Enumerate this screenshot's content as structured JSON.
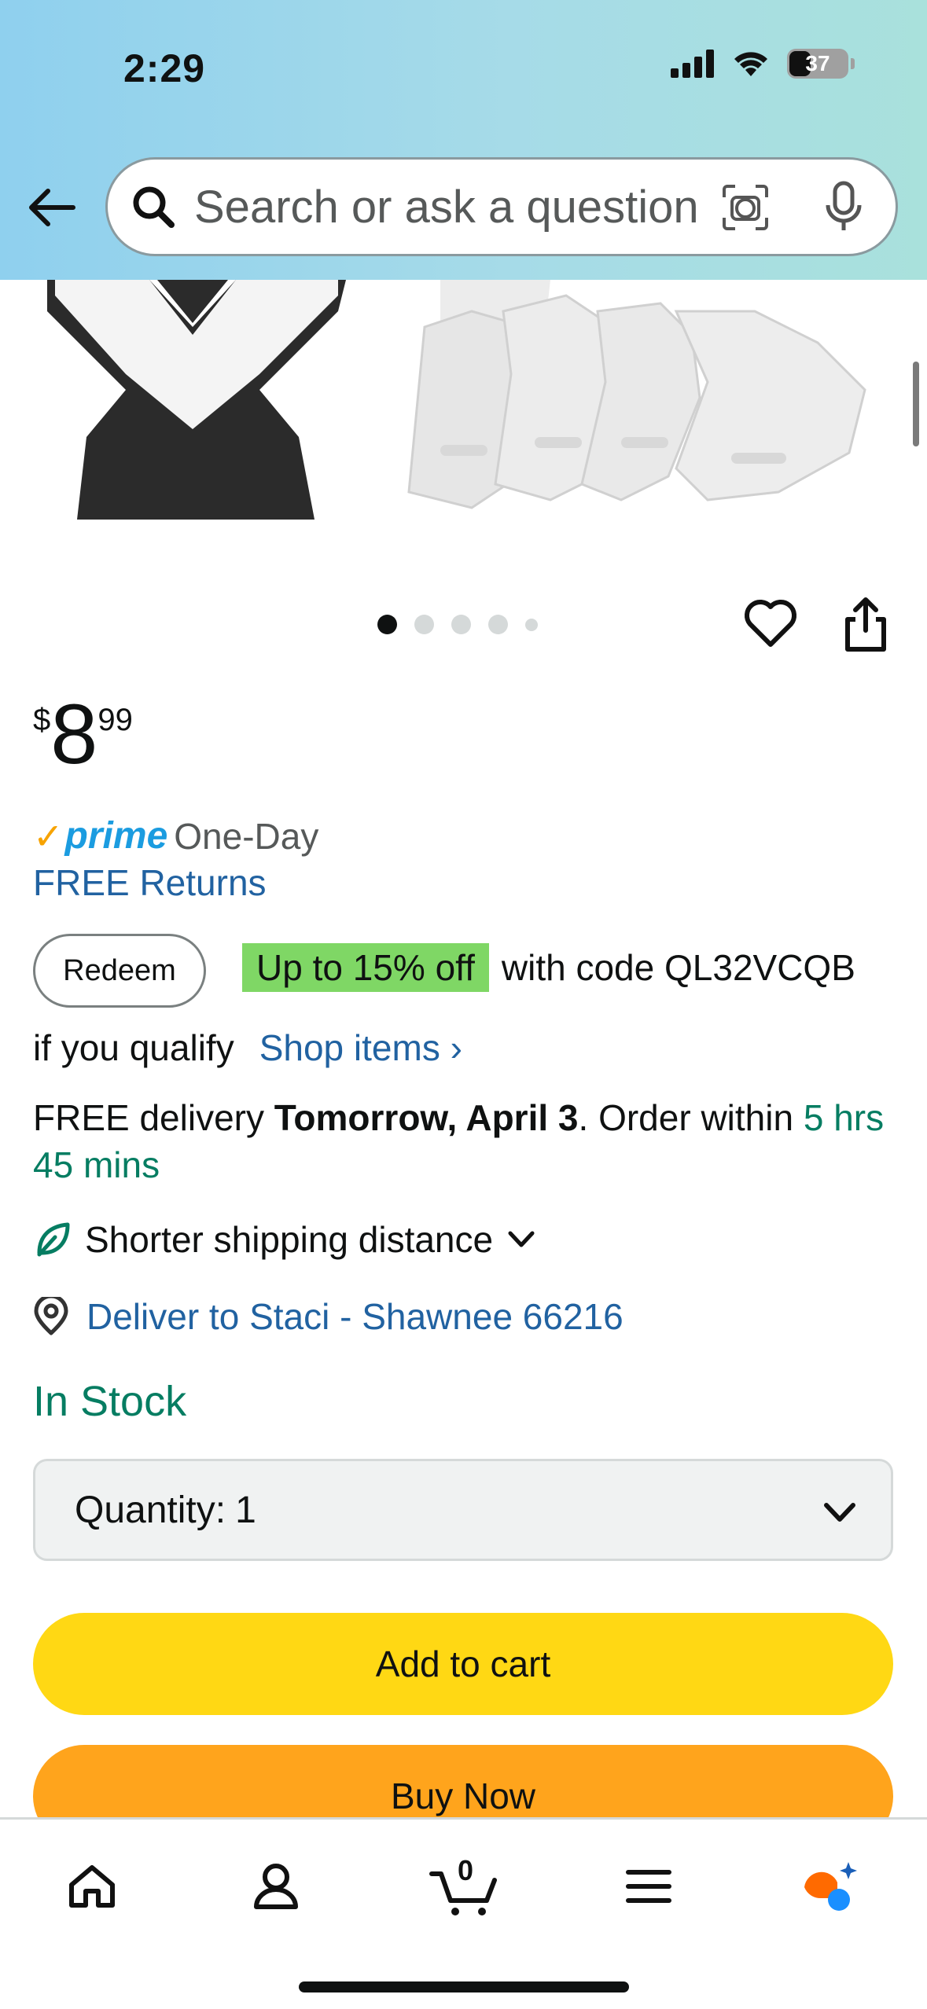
{
  "status_bar": {
    "time": "2:29",
    "battery": "37",
    "icons": [
      "signal-icon",
      "wifi-icon",
      "battery-icon"
    ]
  },
  "header": {
    "back_icon": "back-arrow-icon",
    "search": {
      "placeholder": "Search or ask a question",
      "icons": [
        "search-icon",
        "camera-lens-icon",
        "mic-icon"
      ]
    }
  },
  "gallery": {
    "dots_total": 5,
    "active_dot": 1,
    "icons": [
      "heart-icon",
      "share-icon"
    ]
  },
  "price": {
    "currency": "$",
    "whole": "8",
    "fraction": "99"
  },
  "prime": {
    "check": "✓",
    "word": "prime",
    "label": "One-Day"
  },
  "returns": "FREE Returns",
  "coupon": {
    "redeem_label": "Redeem",
    "badge": "Up to 15% off",
    "code_text": "with code QL32VCQB",
    "qualify_text": "if you qualify",
    "shop_items": "Shop items ›"
  },
  "delivery": {
    "prefix": "FREE delivery ",
    "date": "Tomorrow, April 3",
    "middle": ". Order within ",
    "countdown": "5 hrs 45 mins"
  },
  "shipping": {
    "label": "Shorter shipping distance"
  },
  "deliver_to": "Deliver to Staci - Shawnee 66216",
  "stock": "In Stock",
  "quantity": {
    "label": "Quantity:",
    "value": "1"
  },
  "buttons": {
    "add_to_cart": "Add to cart",
    "buy_now": "Buy Now"
  },
  "bottom_nav": {
    "items": [
      "home-icon",
      "account-icon",
      "cart-icon",
      "menu-icon",
      "rufus-icon"
    ],
    "cart_count": "0"
  },
  "colors": {
    "accent_blue": "#2162a1",
    "green": "#067d62",
    "add_to_cart": "#ffd814",
    "buy_now": "#ffa41c",
    "prime_blue": "#1b9ce0",
    "coupon_green": "#7fd765"
  }
}
